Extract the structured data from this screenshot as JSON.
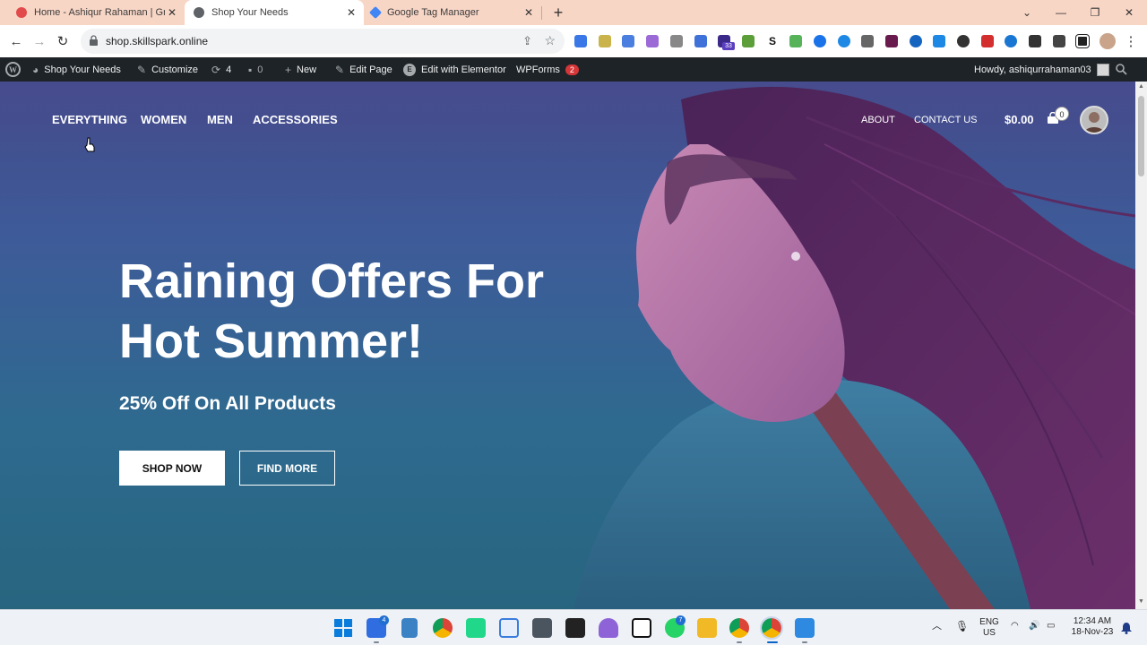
{
  "browser": {
    "tabs": [
      {
        "title": "Home - Ashiqur Rahaman | Grov",
        "active": false
      },
      {
        "title": "Shop Your Needs",
        "active": true
      },
      {
        "title": "Google Tag Manager",
        "active": false
      }
    ],
    "new_tab": "+",
    "window_controls": {
      "minimize": "—",
      "maximize": "❐",
      "close": "✕",
      "tab_search": "⌄"
    },
    "url": "shop.skillspark.online",
    "extension_badge": "33"
  },
  "admin_bar": {
    "site_name": "Shop Your Needs",
    "customize": "Customize",
    "updates_count": "4",
    "comments_count": "0",
    "new": "New",
    "edit_page": "Edit Page",
    "elementor": "Edit with Elementor",
    "wpforms": "WPForms",
    "wpforms_badge": "2",
    "howdy": "Howdy, ashiqurrahaman03"
  },
  "site_nav": {
    "primary": [
      "EVERYTHING",
      "WOMEN",
      "MEN",
      "ACCESSORIES"
    ],
    "secondary": [
      "ABOUT",
      "CONTACT US"
    ],
    "cart_total": "$0.00",
    "cart_count": "0"
  },
  "hero": {
    "headline_line1": "Raining Offers For",
    "headline_line2": "Hot Summer!",
    "subheadline": "25% Off On All Products",
    "primary_cta": "SHOP NOW",
    "secondary_cta": "FIND MORE"
  },
  "taskbar": {
    "badges": {
      "todo": "4",
      "whatsapp": "7"
    },
    "language_line1": "ENG",
    "language_line2": "US",
    "time": "12:34 AM",
    "date": "18-Nov-23"
  },
  "colors": {
    "tab_strip": "#f8d6c6",
    "admin_bar": "#1d2327",
    "hero_top": "#434a8a",
    "hero_bottom": "#27657f",
    "wpforms_badge": "#d63638"
  }
}
